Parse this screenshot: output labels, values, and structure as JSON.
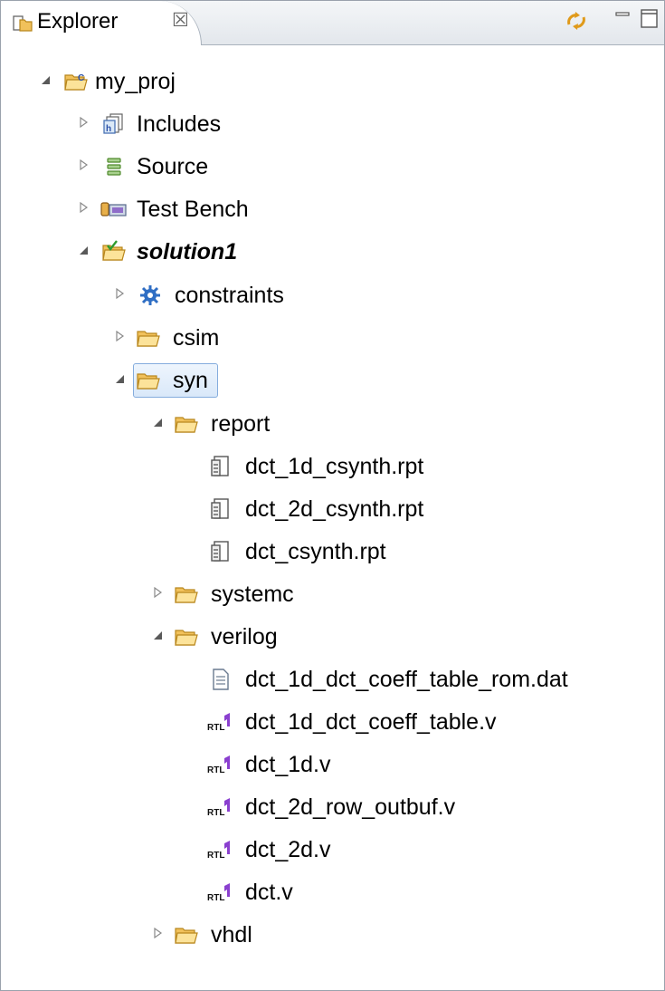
{
  "view": {
    "title": "Explorer",
    "close_glyph": "☒"
  },
  "tree": {
    "project": "my_proj",
    "includes": "Includes",
    "source": "Source",
    "test_bench": "Test Bench",
    "solution": "solution1",
    "constraints": "constraints",
    "csim": "csim",
    "syn": "syn",
    "report": "report",
    "reports": [
      "dct_1d_csynth.rpt",
      "dct_2d_csynth.rpt",
      "dct_csynth.rpt"
    ],
    "systemc": "systemc",
    "verilog": "verilog",
    "verilog_files": [
      "dct_1d_dct_coeff_table_rom.dat",
      "dct_1d_dct_coeff_table.v",
      "dct_1d.v",
      "dct_2d_row_outbuf.v",
      "dct_2d.v",
      "dct.v"
    ],
    "vhdl": "vhdl"
  }
}
